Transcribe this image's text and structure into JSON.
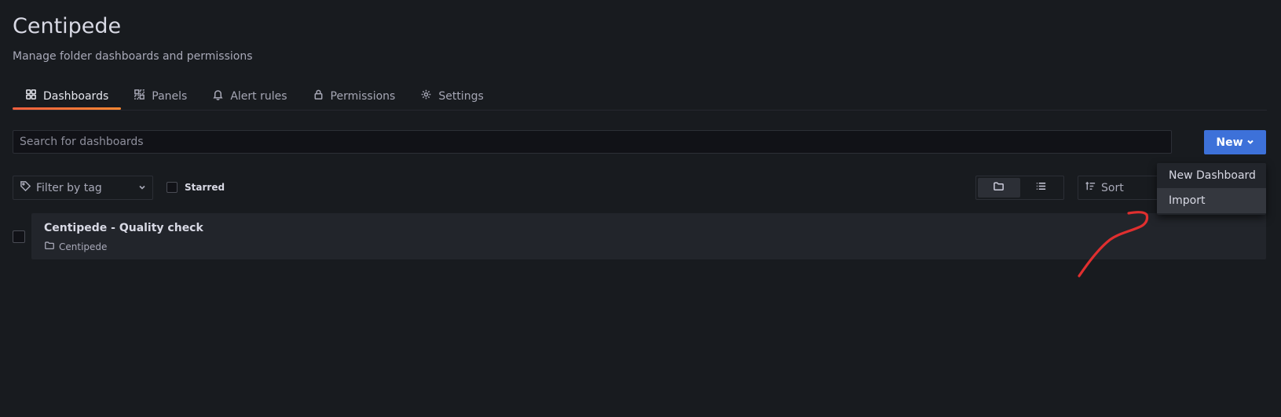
{
  "page": {
    "title": "Centipede",
    "subtitle": "Manage folder dashboards and permissions"
  },
  "tabs": [
    {
      "label": "Dashboards",
      "icon": "apps-icon",
      "active": true
    },
    {
      "label": "Panels",
      "icon": "library-panel-icon",
      "active": false
    },
    {
      "label": "Alert rules",
      "icon": "bell-icon",
      "active": false
    },
    {
      "label": "Permissions",
      "icon": "lock-icon",
      "active": false
    },
    {
      "label": "Settings",
      "icon": "cog-icon",
      "active": false
    }
  ],
  "search": {
    "placeholder": "Search for dashboards",
    "value": ""
  },
  "new_button": {
    "label": "New"
  },
  "filters": {
    "tag_label": "Filter by tag",
    "starred_label": "Starred",
    "sort_label": "Sort",
    "view_mode": "folders"
  },
  "dashboards": [
    {
      "title": "Centipede - Quality check",
      "folder": "Centipede"
    }
  ],
  "new_menu": {
    "items": [
      "New Dashboard",
      "Import"
    ],
    "highlighted": "Import"
  },
  "colors": {
    "background": "#181b1f",
    "primary_button": "#3d71d9",
    "active_tab_underline": "#f55f3e",
    "annotation_arrow": "#e02f2f"
  }
}
